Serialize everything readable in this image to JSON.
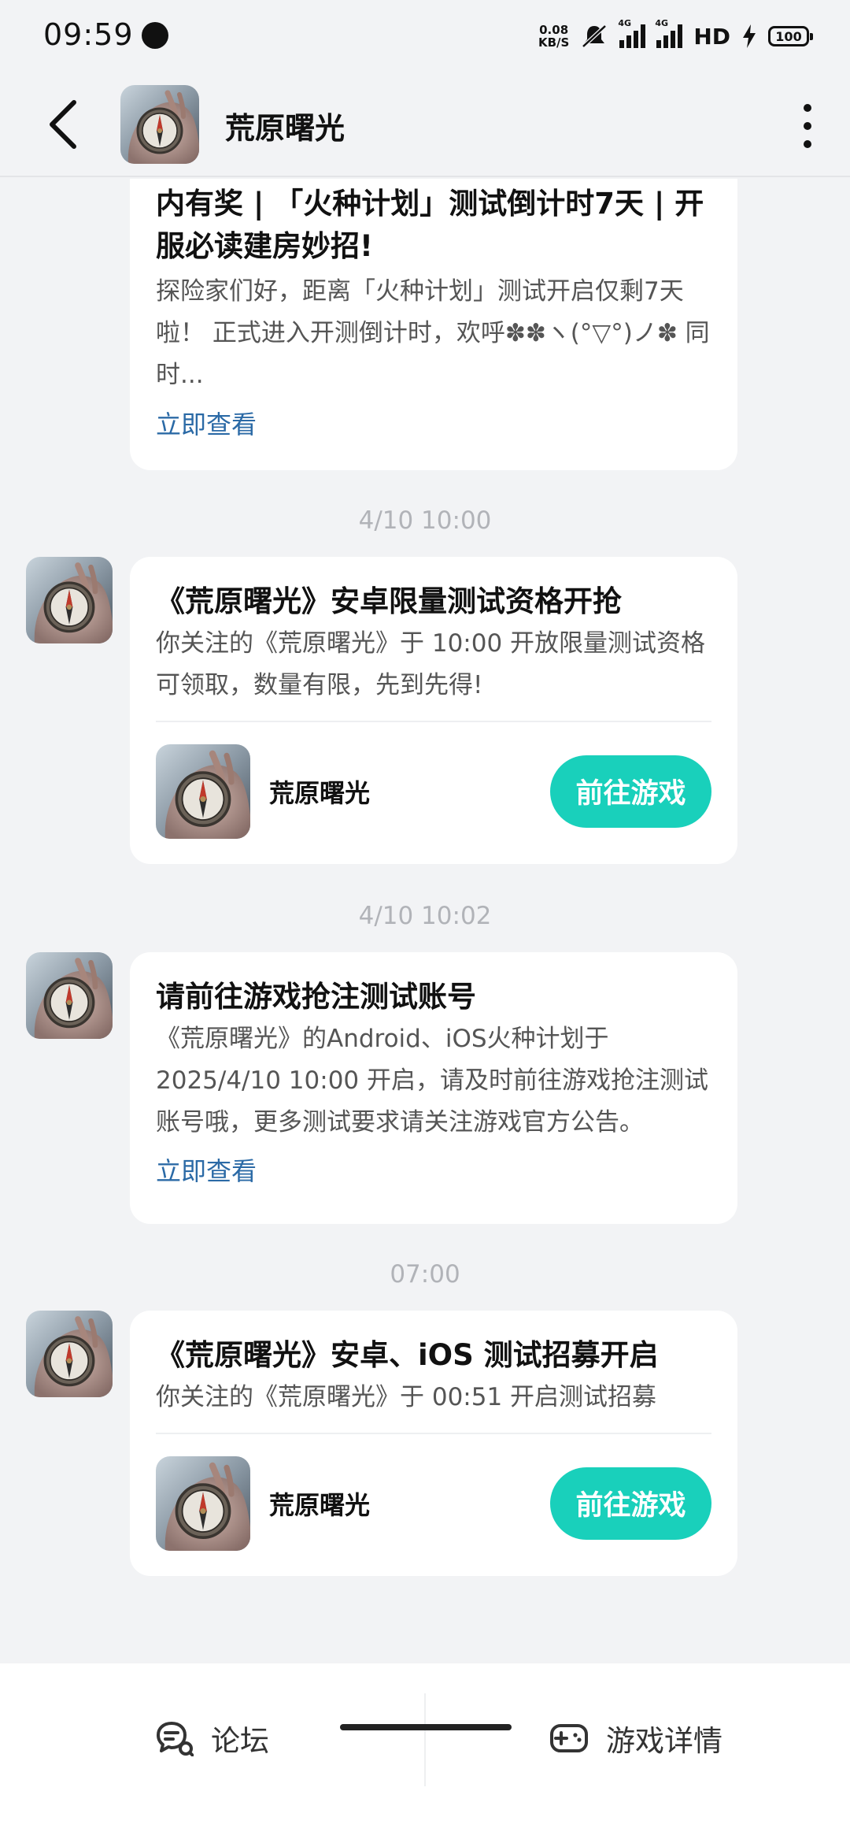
{
  "status_bar": {
    "time": "09:59",
    "net_speed_value": "0.08",
    "net_speed_unit": "KB/S",
    "sim1_label": "4G",
    "sim2_label": "4G",
    "hd_label": "HD",
    "battery": "100"
  },
  "header": {
    "title": "荒原曙光",
    "back_icon": "chevron-left-icon",
    "more_icon": "more-vertical-icon"
  },
  "messages": [
    {
      "title": "内有奖 | 「火种计划」测试倒计时7天 | 开服必读建房妙招!",
      "body": "探险家们好，距离「火种计划」测试开启仅剩7天啦！ 正式进入开测倒计时，欢呼✽✽ヽ(°▽°)ノ✽ 同时...",
      "link": "立即查看"
    },
    {
      "timestamp": "4/10  10:00",
      "title": "《荒原曙光》安卓限量测试资格开抢",
      "body": "你关注的《荒原曙光》于 10:00 开放限量测试资格可领取，数量有限，先到先得!",
      "game_name": "荒原曙光",
      "button": "前往游戏"
    },
    {
      "timestamp": "4/10  10:02",
      "title": "请前往游戏抢注测试账号",
      "body": "《荒原曙光》的Android、iOS火种计划于2025/4/10 10:00 开启，请及时前往游戏抢注测试账号哦，更多测试要求请关注游戏官方公告。",
      "link": "立即查看"
    },
    {
      "timestamp": "07:00",
      "title": "《荒原曙光》安卓、iOS 测试招募开启",
      "body": "你关注的《荒原曙光》于 00:51 开启测试招募",
      "game_name": "荒原曙光",
      "button": "前往游戏"
    }
  ],
  "bottom_bar": {
    "forum_label": "论坛",
    "forum_icon": "forum-chat-icon",
    "details_label": "游戏详情",
    "details_icon": "gamepad-icon"
  },
  "colors": {
    "accent": "#19d0bb",
    "link": "#2b6aa6",
    "background": "#f2f3f5"
  }
}
